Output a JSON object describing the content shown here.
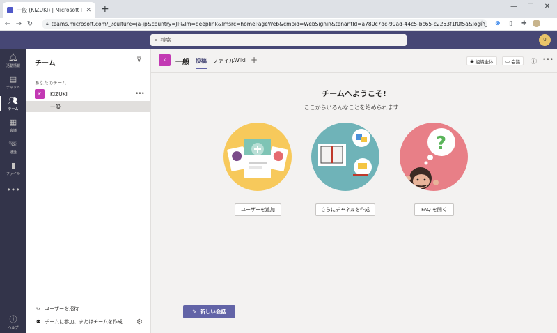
{
  "browser": {
    "tab_title": "一般 (KIZUKI) | Microsoft Teams",
    "url": "teams.microsoft.com/_?culture=ja-jp&country=JP&lm=deeplink&lmsrc=homePageWeb&cmpid=WebSignin&tenantId=a780c7dc-99ad-44c5-bc65-c2253f1f0f5a&login_hint..."
  },
  "header": {
    "search_placeholder": "検索",
    "user_initials": "U"
  },
  "app_bar": {
    "items": [
      {
        "label": "活動情報",
        "icon": "bell-icon"
      },
      {
        "label": "チャット",
        "icon": "chat-icon"
      },
      {
        "label": "チーム",
        "icon": "teams-icon"
      },
      {
        "label": "会議",
        "icon": "calendar-icon"
      },
      {
        "label": "通話",
        "icon": "phone-icon"
      },
      {
        "label": "ファイル",
        "icon": "file-icon"
      }
    ],
    "more": "•••",
    "help_label": "ヘルプ"
  },
  "teams_panel": {
    "title": "チーム",
    "section_label": "あなたのチーム",
    "team_name": "KIZUKI",
    "team_avatar": "K",
    "channel_name": "一般",
    "invite_label": "ユーザーを招待",
    "join_label": "チームに参加、またはチームを作成"
  },
  "channel": {
    "avatar": "K",
    "title": "一般",
    "tabs": [
      "投稿",
      "ファイル",
      "Wiki"
    ],
    "org_wide": "組織全体",
    "meet": "会議"
  },
  "welcome": {
    "title": "チームへようこそ!",
    "subtitle": "ここからいろんなことを始められます...",
    "add_users": "ユーザーを追加",
    "create_channels": "さらにチャネルを作成",
    "open_faq": "FAQ を開く"
  },
  "new_conversation": "新しい会話",
  "colors": {
    "teams_purple": "#464775",
    "accent": "#6264a7",
    "team_avatar": "#c239b3"
  }
}
